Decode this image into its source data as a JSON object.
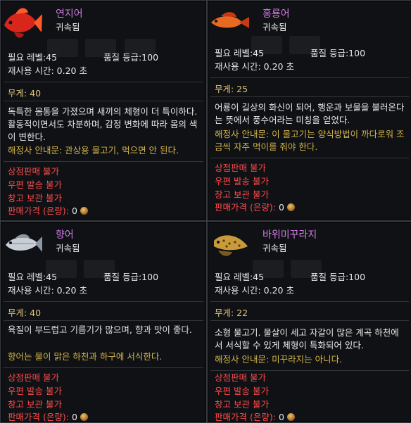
{
  "tooltips": [
    {
      "name": "연지어",
      "bound": "귀속됨",
      "required_level": "필요 레벨:45",
      "quality": "품질 등급:100",
      "cooldown": "재사용 시간: 0.20 초",
      "weight": "무게: 40",
      "description": "독특한 몸통을 가졌으며 새끼의 체형이 더 특이하다. 활동적이면서도 차분하며, 감정 변화에 따라 몸의 색이 변한다.",
      "hint": "해정사 안내문: 관상용 물고기, 먹으면 안 된다.",
      "restrictions": [
        "상점판매 불가",
        "우편 발송 불가",
        "창고 보관 불가"
      ],
      "price_label": "판매가격 (은량):",
      "price_value": "0",
      "icon": "red-fish-icon",
      "icon_colors": {
        "body": "#d8261c",
        "fin": "#ff5a2a"
      }
    },
    {
      "name": "홍룡어",
      "bound": "귀속됨",
      "required_level": "필요 레벨:45",
      "quality": "품질 등급:100",
      "cooldown": "재사용 시간: 0.20 초",
      "weight": "무게: 25",
      "description": "어룡이 길상의 화신이 되어, 행운과 보물을 불러온다는 뜻에서 풍수어라는 미칭을 얻었다.",
      "hint": "해정사 안내문: 이 물고기는 양식방법이 까다로워 조금씩 자주 먹이를 줘야 한다.",
      "restrictions": [
        "상점판매 불가",
        "우편 발송 불가",
        "창고 보관 불가"
      ],
      "price_label": "판매가격 (은량):",
      "price_value": "0",
      "icon": "red-arowana-icon",
      "icon_colors": {
        "body": "#e86a22",
        "fin": "#c43a14"
      }
    },
    {
      "name": "향어",
      "bound": "귀속됨",
      "required_level": "필요 레벨:45",
      "quality": "품질 등급:100",
      "cooldown": "재사용 시간: 0.20 초",
      "weight": "무게: 40",
      "description": "육질이 부드럽고 기름기가 많으며, 향과 맛이 좋다.",
      "hint": "향어는 물이 맑은 하천과 하구에 서식한다.",
      "restrictions": [
        "상점판매 불가",
        "우편 발송 불가",
        "창고 보관 불가"
      ],
      "price_label": "판매가격 (은량):",
      "price_value": "0",
      "icon": "silver-fish-icon",
      "icon_colors": {
        "body": "#c8ced6",
        "fin": "#8a96a4"
      }
    },
    {
      "name": "바위미꾸라지",
      "bound": "귀속됨",
      "required_level": "필요 레벨:45",
      "quality": "품질 등급:100",
      "cooldown": "재사용 시간: 0.20 초",
      "weight": "무게: 22",
      "description": "소형 물고기. 물살이 세고 자갈이 많은 계곡 하천에서 서식할 수 있게 체형이 특화되어 있다.",
      "hint": "해정사 안내문: 미꾸라지는 아니다.",
      "restrictions": [
        "상점판매 불가",
        "우편 발송 불가",
        "창고 보관 불가"
      ],
      "price_label": "판매가격 (은량):",
      "price_value": "0",
      "icon": "spotted-loach-icon",
      "icon_colors": {
        "body": "#c99a3a",
        "fin": "#7a5a20"
      }
    }
  ]
}
